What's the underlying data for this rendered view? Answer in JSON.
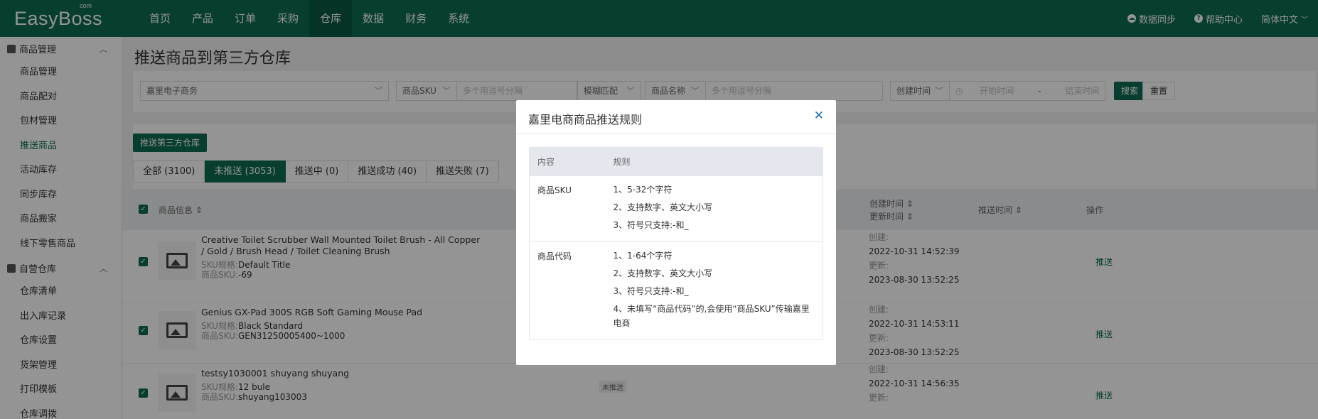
{
  "app": {
    "logo": "EasyBoss",
    "logo_suffix": "com"
  },
  "topnav": {
    "items": [
      {
        "label": "首页",
        "active": false
      },
      {
        "label": "产品",
        "active": false
      },
      {
        "label": "订单",
        "active": false
      },
      {
        "label": "采购",
        "active": false
      },
      {
        "label": "仓库",
        "active": true
      },
      {
        "label": "数据",
        "active": false
      },
      {
        "label": "财务",
        "active": false
      },
      {
        "label": "系统",
        "active": false
      }
    ],
    "data_sync": "数据同步",
    "help_center": "帮助中心",
    "language": "简体中文"
  },
  "sidebar": {
    "group1": "商品管理",
    "group1_items": [
      "商品管理",
      "商品配对",
      "包材管理",
      "推送商品",
      "活动库存",
      "同步库存",
      "商品搬家",
      "线下零售商品"
    ],
    "group1_active_index": 3,
    "group2": "自营仓库",
    "group2_items": [
      "仓库清单",
      "出入库记录",
      "仓库设置",
      "货架管理",
      "打印模板",
      "仓库调拨"
    ]
  },
  "page": {
    "title": "推送商品到第三方仓库"
  },
  "filters": {
    "warehouse": "嘉里电子商务",
    "sku_type": "商品SKU",
    "sku_placeholder": "多个用逗号分隔",
    "match_mode": "模糊匹配",
    "name_type": "商品名称",
    "name_placeholder": "多个用逗号分隔",
    "time_type": "创建时间",
    "start_placeholder": "开始时间",
    "range_sep": "-",
    "end_placeholder": "结束时间",
    "search_btn": "搜索",
    "reset_btn": "重置"
  },
  "actions": {
    "push_btn": "推送第三方仓库"
  },
  "tabs": [
    {
      "label": "全部 (3100)",
      "active": false
    },
    {
      "label": "未推送 (3053)",
      "active": true
    },
    {
      "label": "推送中 (0)",
      "active": false
    },
    {
      "label": "推送成功 (40)",
      "active": false
    },
    {
      "label": "推送失败 (7)",
      "active": false
    }
  ],
  "table": {
    "col_product": "商品信息 ⇕",
    "col_created": "创建时间 ⇕",
    "col_updated": "更新时间 ⇕",
    "col_push_time": "推送时间 ⇕",
    "col_action": "操作",
    "sku_label": "SKU规格:",
    "code_label": "商品SKU:",
    "created_label": "创建:",
    "updated_label": "更新:",
    "push_link": "推送",
    "rows": [
      {
        "title": "Creative Toilet Scrubber Wall Mounted Toilet Brush - All Copper / Gold / Brush Head / Toilet Cleaning Brush",
        "sku_spec": "Default Title",
        "sku_code": "-69",
        "created": "2022-10-31 14:52:39",
        "updated": "2023-08-30 13:52:25"
      },
      {
        "title": "Genius GX-Pad 300S RGB Soft Gaming Mouse Pad",
        "sku_spec": "Black Standard",
        "sku_code": "GEN31250005400~1000",
        "created": "2022-10-31 14:53:11",
        "updated": "2023-08-30 13:52:25"
      },
      {
        "title": "testsy1030001 shuyang shuyang",
        "sku_spec": "12 bule",
        "sku_code": "shuyang103003",
        "created": "2022-10-31 14:56:35",
        "status": "未推送"
      }
    ]
  },
  "modal": {
    "title": "嘉里电商商品推送规则",
    "col_content": "内容",
    "col_rule": "规则",
    "rules": [
      {
        "key": "商品SKU",
        "lines": [
          "1、5-32个字符",
          "2、支持数字、英文大小写",
          "3、符号只支持:-和_"
        ]
      },
      {
        "key": "商品代码",
        "lines": [
          "1、1-64个字符",
          "2、支持数字、英文大小写",
          "3、符号只支持:-和_",
          "4、未填写“商品代码”的,会使用“商品SKU”传输嘉里电商"
        ]
      }
    ]
  }
}
